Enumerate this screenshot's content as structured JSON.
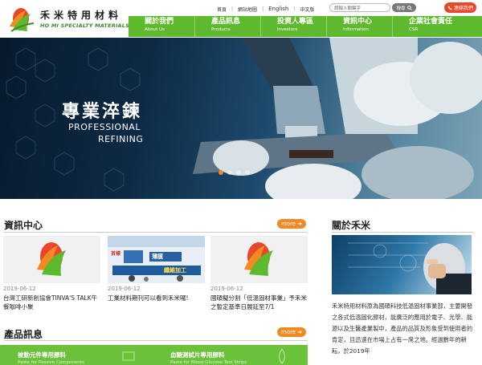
{
  "brand": {
    "name_cn": "禾米特用材料",
    "name_en": "HO MI SPECIALTY MATERIALS",
    "colors": {
      "green": "#5fb92e",
      "orange": "#f28a24",
      "red": "#e8472a"
    }
  },
  "utility": {
    "home": "首頁",
    "sitemap": "網站地圖",
    "english": "English",
    "chinese": "中文版",
    "search_placeholder": "請輸入關鍵字",
    "search_button": "搜尋",
    "contact_button": "連絡我們"
  },
  "nav": [
    {
      "cn": "關於我們",
      "en": "About Us"
    },
    {
      "cn": "產品訊息",
      "en": "Products"
    },
    {
      "cn": "投資人專區",
      "en": "Investors"
    },
    {
      "cn": "資訊中心",
      "en": "Information"
    },
    {
      "cn": "企業社會責任",
      "en": "CSR"
    }
  ],
  "hero": {
    "title": "專業淬鍊",
    "subtitle_line1": "PROFESSIONAL",
    "subtitle_line2": "REFINING",
    "slides": 4,
    "active_slide": 1
  },
  "news": {
    "title": "資訊中心",
    "more": "more",
    "items": [
      {
        "date": "2019-06-12",
        "text": "台灣工研新創協會TINVA'S TALK午餐咖啡小聚"
      },
      {
        "date": "2019-06-12",
        "text": "工業材料期刊可以看到禾米囉!"
      },
      {
        "date": "2019-06-12",
        "text": "國碩擬分割「低溫固材事業」予禾米之暫定基準日展延至7/1"
      }
    ],
    "magazine": {
      "top_left": "首樣",
      "top_right": "薄膜",
      "bottom": "纖維加工"
    }
  },
  "about": {
    "title": "關於禾米",
    "text": "禾米特用材料原為國碩科技低溫固材事業部，主要開發之各式低溫固化膠材，能廣泛的應用於電子、光學、能源以及生醫產業製中，產品的品質及形象受到使用者的肯定，且迅速在市場上占有一席之地。經過數年的耕耘，於2019年"
  },
  "products": {
    "title": "產品訊息",
    "more": "more",
    "items": [
      {
        "label": "被動元件專用膠料",
        "sub": "Paste for Passive Components"
      },
      {
        "label": "血糖測試片專用膠料",
        "sub": "Paste for Blood Glucose Test Strips"
      }
    ]
  }
}
